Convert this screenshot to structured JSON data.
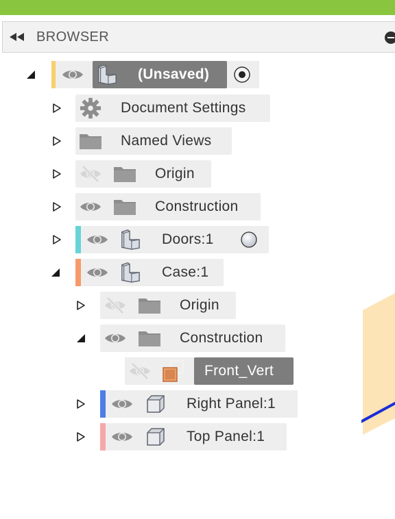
{
  "header": {
    "title": "BROWSER",
    "collapse_icon": "double-arrow-left-icon",
    "options_icon": "minus-circle-icon"
  },
  "colors": {
    "top_bar": "#8ac53f",
    "selected_background": "#7d7d7d",
    "row_background": "#eeeeee"
  },
  "tree": {
    "root": {
      "label": "(Unsaved)",
      "expanded": true,
      "color": "#f8cf6a",
      "visible": true,
      "active_component_radio": "selected"
    },
    "document_settings": {
      "label": "Document Settings",
      "expanded": false,
      "icon": "gear-icon"
    },
    "named_views": {
      "label": "Named Views",
      "expanded": false,
      "icon": "folder-icon"
    },
    "origin": {
      "label": "Origin",
      "expanded": false,
      "visible": false,
      "icon": "folder-icon"
    },
    "construction": {
      "label": "Construction",
      "expanded": false,
      "visible": true,
      "icon": "folder-icon"
    },
    "doors": {
      "label": "Doors:1",
      "expanded": false,
      "visible": true,
      "color": "#66d4d8",
      "icon": "component-icon",
      "radio": "unselected"
    },
    "case": {
      "label": "Case:1",
      "expanded": true,
      "visible": true,
      "color": "#f79a6a",
      "icon": "component-icon",
      "origin": {
        "label": "Origin",
        "expanded": false,
        "visible": false,
        "icon": "folder-icon"
      },
      "construction": {
        "label": "Construction",
        "expanded": true,
        "visible": true,
        "icon": "folder-icon",
        "front_vert": {
          "label": "Front_Vert",
          "visible": false,
          "selected": true,
          "icon": "plane-icon"
        }
      },
      "right_panel": {
        "label": "Right Panel:1",
        "expanded": false,
        "visible": true,
        "color": "#4f7de6",
        "icon": "body-icon"
      },
      "top_panel": {
        "label": "Top Panel:1",
        "expanded": false,
        "visible": true,
        "color": "#f6a8a8",
        "icon": "body-icon"
      }
    }
  }
}
